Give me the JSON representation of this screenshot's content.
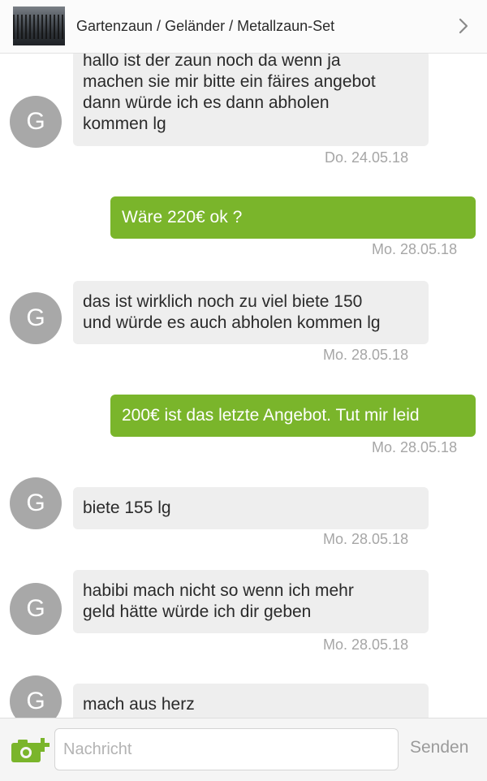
{
  "header": {
    "title": "Gartenzaun / Geländer / Metallzaun-Set",
    "thumbnail_icon": "fence-thumbnail",
    "chevron_icon": "chevron-right-icon"
  },
  "avatar_letter": "G",
  "messages": [
    {
      "dir": "in",
      "text": "hallo ist der zaun noch da wenn ja\nmachen sie mir bitte ein fäires angebot\ndann würde ich es dann abholen\nkommen lg",
      "time": "Do. 24.05.18"
    },
    {
      "dir": "out",
      "text": "Wäre 220€ ok ?",
      "time": "Mo. 28.05.18"
    },
    {
      "dir": "in",
      "text": "das ist wirklich noch zu viel biete 150\nund würde es auch abholen kommen lg",
      "time": "Mo. 28.05.18"
    },
    {
      "dir": "out",
      "text": "200€ ist das letzte Angebot. Tut mir leid",
      "time": "Mo. 28.05.18"
    },
    {
      "dir": "in",
      "text": "biete 155 lg",
      "time": "Mo. 28.05.18"
    },
    {
      "dir": "in",
      "text": "habibi mach nicht so wenn ich mehr\ngeld hätte würde ich dir geben",
      "time": "Mo. 28.05.18"
    },
    {
      "dir": "in",
      "text": "mach aus herz",
      "time": ""
    }
  ],
  "composer": {
    "placeholder": "Nachricht",
    "send_label": "Senden",
    "camera_icon": "camera-add-icon"
  },
  "colors": {
    "outgoing_bubble": "#7ab52b",
    "incoming_bubble": "#eeeeee",
    "avatar": "#a8a8a8",
    "timestamp": "#a6a6a6"
  }
}
